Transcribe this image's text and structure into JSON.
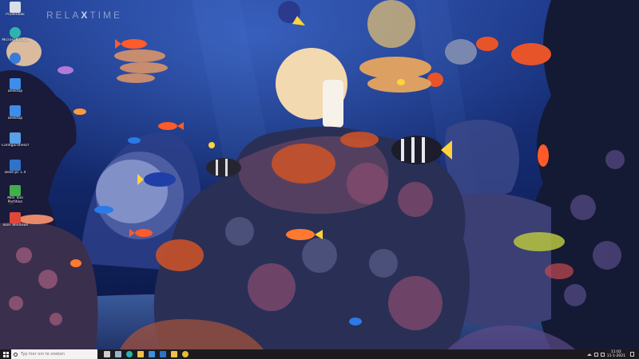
{
  "wallpaper": {
    "watermark_left": "RELA",
    "watermark_x": "X",
    "watermark_right": "TIME"
  },
  "desktop_icons": [
    {
      "label": "Prullenbak",
      "icon": "recycle-bin-icon",
      "color": "#d9dee8"
    },
    {
      "label": "Microsoft Edge",
      "icon": "edge-icon",
      "color": "#2fb4ad"
    },
    {
      "label": "",
      "icon": "app-icon",
      "color": "#3a7bd5"
    },
    {
      "label": "Desktop",
      "icon": "monitor-icon",
      "color": "#3c8ee8"
    },
    {
      "label": "Desktop",
      "icon": "monitor-icon",
      "color": "#3c8ee8"
    },
    {
      "label": "Configuratiescherm",
      "icon": "control-panel-icon",
      "color": "#5aa0e6"
    },
    {
      "label": "Deze pc 1.4",
      "icon": "computer-icon",
      "color": "#2f73c9"
    },
    {
      "label": "Mini Tool Partition Wizard",
      "icon": "partition-tool-icon",
      "color": "#3fb04a"
    },
    {
      "label": "Tools Windows",
      "icon": "tools-icon",
      "color": "#e0473a"
    }
  ],
  "taskbar": {
    "search_placeholder": "Typ hier om te zoeken",
    "apps": [
      {
        "icon": "task-view-icon",
        "color": "#cfcfcf"
      },
      {
        "icon": "widgets-icon",
        "color": "#9ab0c8"
      },
      {
        "icon": "edge-icon",
        "color": "#2fb4ad"
      },
      {
        "icon": "file-explorer-icon",
        "color": "#f2c04a"
      },
      {
        "icon": "store-icon",
        "color": "#3a8fe0"
      },
      {
        "icon": "mail-icon",
        "color": "#2f73c9"
      },
      {
        "icon": "folder-icon",
        "color": "#f2c04a"
      },
      {
        "icon": "chrome-icon",
        "color": "#e8b93a"
      }
    ],
    "clock_time": "11:02",
    "clock_date": "11-1-2021"
  }
}
